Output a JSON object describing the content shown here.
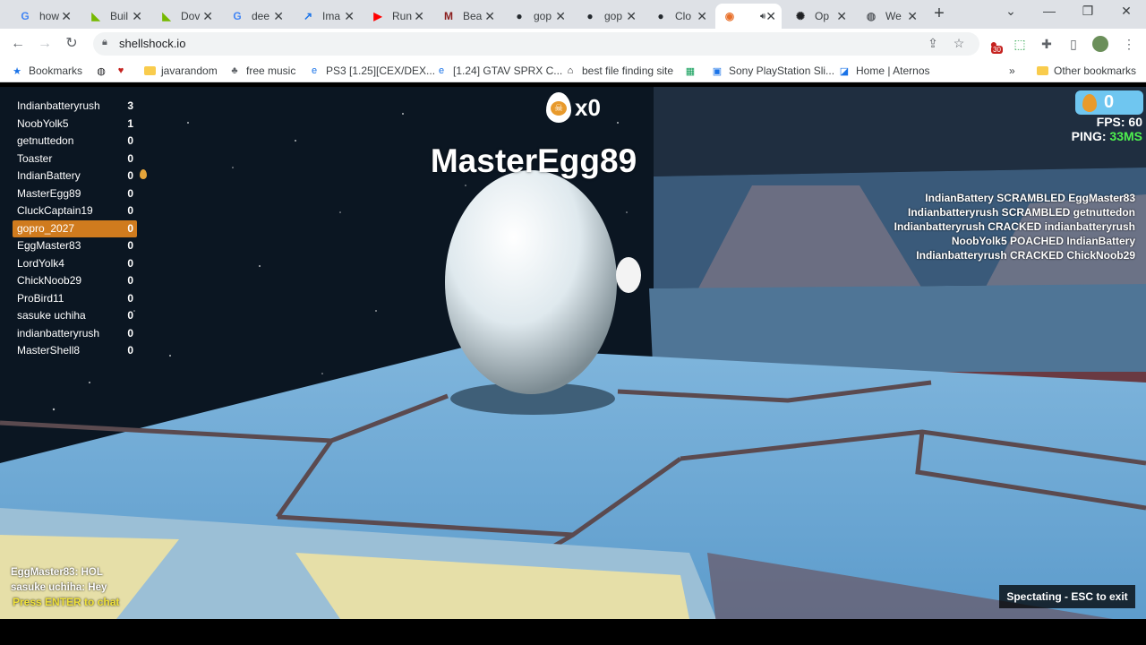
{
  "browser": {
    "tabs": [
      {
        "label": "how",
        "icon": "google-icon"
      },
      {
        "label": "Buil",
        "icon": "nvidia-icon"
      },
      {
        "label": "Dov",
        "icon": "nvidia-icon"
      },
      {
        "label": "dee",
        "icon": "google-icon"
      },
      {
        "label": "Ima",
        "icon": "trend-icon"
      },
      {
        "label": "Run",
        "icon": "youtube-icon"
      },
      {
        "label": "Bea",
        "icon": "medium-icon"
      },
      {
        "label": "gop",
        "icon": "github-icon"
      },
      {
        "label": "gop",
        "icon": "github-icon"
      },
      {
        "label": "Clo",
        "icon": "github-icon"
      },
      {
        "label": "",
        "icon": "shellshock-icon",
        "active": true
      },
      {
        "label": "Op",
        "icon": "openai-icon"
      },
      {
        "label": "We",
        "icon": "globe-icon"
      }
    ],
    "url": "shellshock.io",
    "extension_badge": "30",
    "bookmarks": [
      {
        "label": "Bookmarks",
        "icon": "star-icon"
      },
      {
        "label": "",
        "icon": "globe-icon"
      },
      {
        "label": "",
        "icon": "heart-icon"
      },
      {
        "label": "javarandom",
        "icon": "folder-icon"
      },
      {
        "label": "free music",
        "icon": "alien-icon"
      },
      {
        "label": "PS3 [1.25][CEX/DEX...",
        "icon": "e-icon"
      },
      {
        "label": "[1.24] GTAV SPRX C...",
        "icon": "e-icon"
      },
      {
        "label": "best file finding site",
        "icon": "tool-icon"
      },
      {
        "label": "",
        "icon": "sheet-icon"
      },
      {
        "label": "Sony PlayStation Sli...",
        "icon": "sony-icon"
      },
      {
        "label": "Home | Aternos",
        "icon": "aternos-icon"
      },
      {
        "label": "Other bookmarks",
        "icon": "folder-icon"
      }
    ]
  },
  "game": {
    "scoreboard": [
      {
        "name": "Indianbatteryrush",
        "score": "3"
      },
      {
        "name": "NoobYolk5",
        "score": "1"
      },
      {
        "name": "getnuttedon",
        "score": "0"
      },
      {
        "name": "Toaster",
        "score": "0"
      },
      {
        "name": "IndianBattery",
        "score": "0"
      },
      {
        "name": "MasterEgg89",
        "score": "0"
      },
      {
        "name": "CluckCaptain19",
        "score": "0"
      },
      {
        "name": "gopro_2027",
        "score": "0",
        "me": true
      },
      {
        "name": "EggMaster83",
        "score": "0"
      },
      {
        "name": "LordYolk4",
        "score": "0"
      },
      {
        "name": "ChickNoob29",
        "score": "0"
      },
      {
        "name": "ProBird11",
        "score": "0"
      },
      {
        "name": "sasuke uchiha",
        "score": "0"
      },
      {
        "name": "indianbatteryrush",
        "score": "0"
      },
      {
        "name": "MasterShell8",
        "score": "0"
      }
    ],
    "kill_streak": "x0",
    "spectated_player": "MasterEgg89",
    "golden_eggs": "0",
    "fps_label": "FPS: 60",
    "ping_label": "PING:",
    "ping_value": "33MS",
    "killfeed": [
      "IndianBattery SCRAMBLED EggMaster83",
      "Indianbatteryrush SCRAMBLED getnuttedon",
      "Indianbatteryrush CRACKED indianbatteryrush",
      "NoobYolk5 POACHED IndianBattery",
      "Indianbatteryrush CRACKED ChickNoob29"
    ],
    "chat": [
      "EggMaster83: HOL",
      "sasuke uchiha: Hey"
    ],
    "chat_prompt": "Press ENTER to chat",
    "spectate_label": "Spectating - ESC to exit"
  }
}
